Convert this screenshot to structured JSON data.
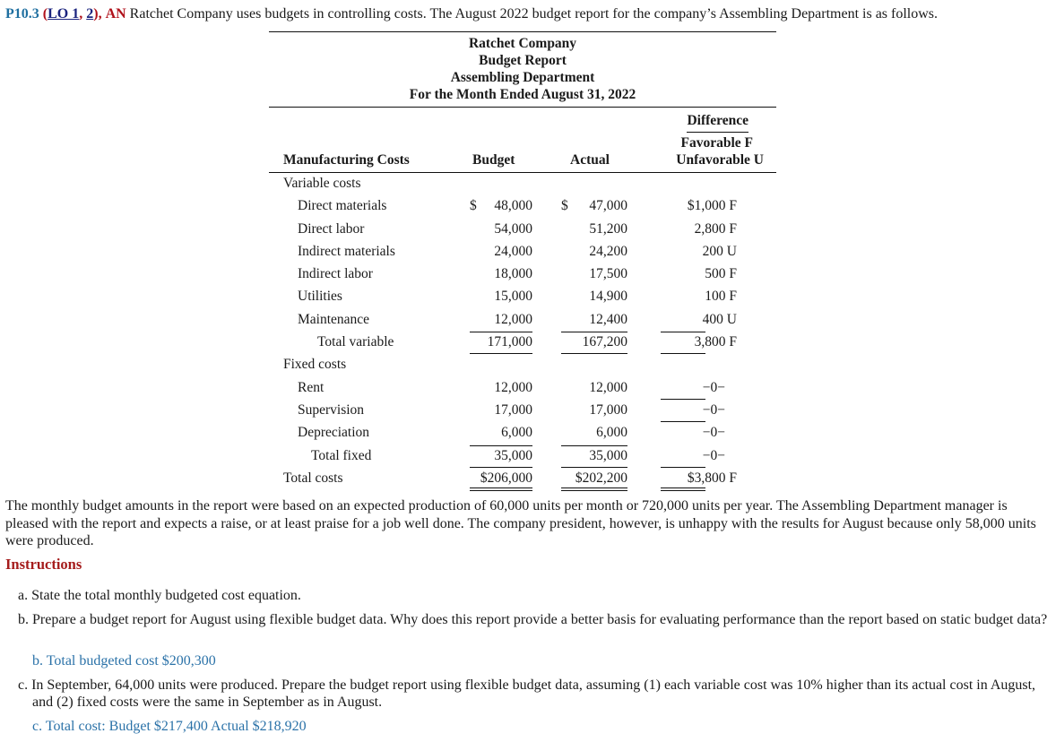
{
  "problem": {
    "id": "P10.3",
    "lo_open": "(",
    "lo_label": "LO 1",
    "lo_sep": ", ",
    "lo_2": "2",
    "lo_close": "),",
    "tag": "AN",
    "intro": "Ratchet Company uses budgets in controlling costs. The August 2022 budget report for the company’s Assembling Department is as follows."
  },
  "report": {
    "heading": [
      "Ratchet Company",
      "Budget Report",
      "Assembling Department",
      "For the Month Ended August 31, 2022"
    ],
    "columns": {
      "label": "Manufacturing Costs",
      "budget": "Budget",
      "actual": "Actual",
      "diff_top": "Difference",
      "diff_fav": "Favorable F",
      "diff_unfav": "Unfavorable U"
    },
    "variable_section": "Variable costs",
    "variable_rows": [
      {
        "label": "Direct materials",
        "budget": "48,000",
        "actual": "47,000",
        "diff": "$1,000 F",
        "dollar": true
      },
      {
        "label": "Direct labor",
        "budget": "54,000",
        "actual": "51,200",
        "diff": "2,800 F"
      },
      {
        "label": "Indirect materials",
        "budget": "24,000",
        "actual": "24,200",
        "diff": "200 U"
      },
      {
        "label": "Indirect labor",
        "budget": "18,000",
        "actual": "17,500",
        "diff": "500 F"
      },
      {
        "label": "Utilities",
        "budget": "15,000",
        "actual": "14,900",
        "diff": "100 F"
      },
      {
        "label": "Maintenance",
        "budget": "12,000",
        "actual": "12,400",
        "diff": "400 U"
      }
    ],
    "total_variable": {
      "label": "Total variable",
      "budget": "171,000",
      "actual": "167,200",
      "diff": "3,800 F"
    },
    "fixed_section": "Fixed costs",
    "fixed_rows": [
      {
        "label": "Rent",
        "budget": "12,000",
        "actual": "12,000",
        "diff": "−0−"
      },
      {
        "label": "Supervision",
        "budget": "17,000",
        "actual": "17,000",
        "diff": "−0−"
      },
      {
        "label": "Depreciation",
        "budget": "6,000",
        "actual": "6,000",
        "diff": "−0−"
      }
    ],
    "total_fixed": {
      "label": "Total fixed",
      "budget": "35,000",
      "actual": "35,000",
      "diff": "−0−"
    },
    "total_costs": {
      "label": "Total costs",
      "budget": "$206,000",
      "actual": "$202,200",
      "diff": "$3,800 F"
    },
    "dollar_sign": "$"
  },
  "paragraph": "The monthly budget amounts in the report were based on an expected production of 60,000 units per month or 720,000 units per year. The Assembling Department manager is pleased with the report and expects a raise, or at least praise for a job well done. The company president, however, is unhappy with the results for August because only 58,000 units were produced.",
  "instructions": {
    "title": "Instructions",
    "items": [
      {
        "text": "a. State the total monthly budgeted cost equation."
      },
      {
        "text": "b. Prepare a budget report for August using flexible budget data. Why does this report provide a better basis for evaluating performance than the report based on static budget data?",
        "answer": "b. Total budgeted cost $200,300"
      },
      {
        "text": "c. In September, 64,000 units were produced. Prepare the budget report using flexible budget data, assuming (1) each variable cost was 10% higher than its actual cost in August, and (2) fixed costs were the same in September as in August.",
        "answer": "c. Total cost: Budget $217,400 Actual $218,920"
      }
    ]
  },
  "colors": {
    "problem_id": "#1f6fa0",
    "tag": "#b0121b",
    "instructions": "#a51c1c",
    "answer": "#2b72a8",
    "link": "#1a237e"
  }
}
